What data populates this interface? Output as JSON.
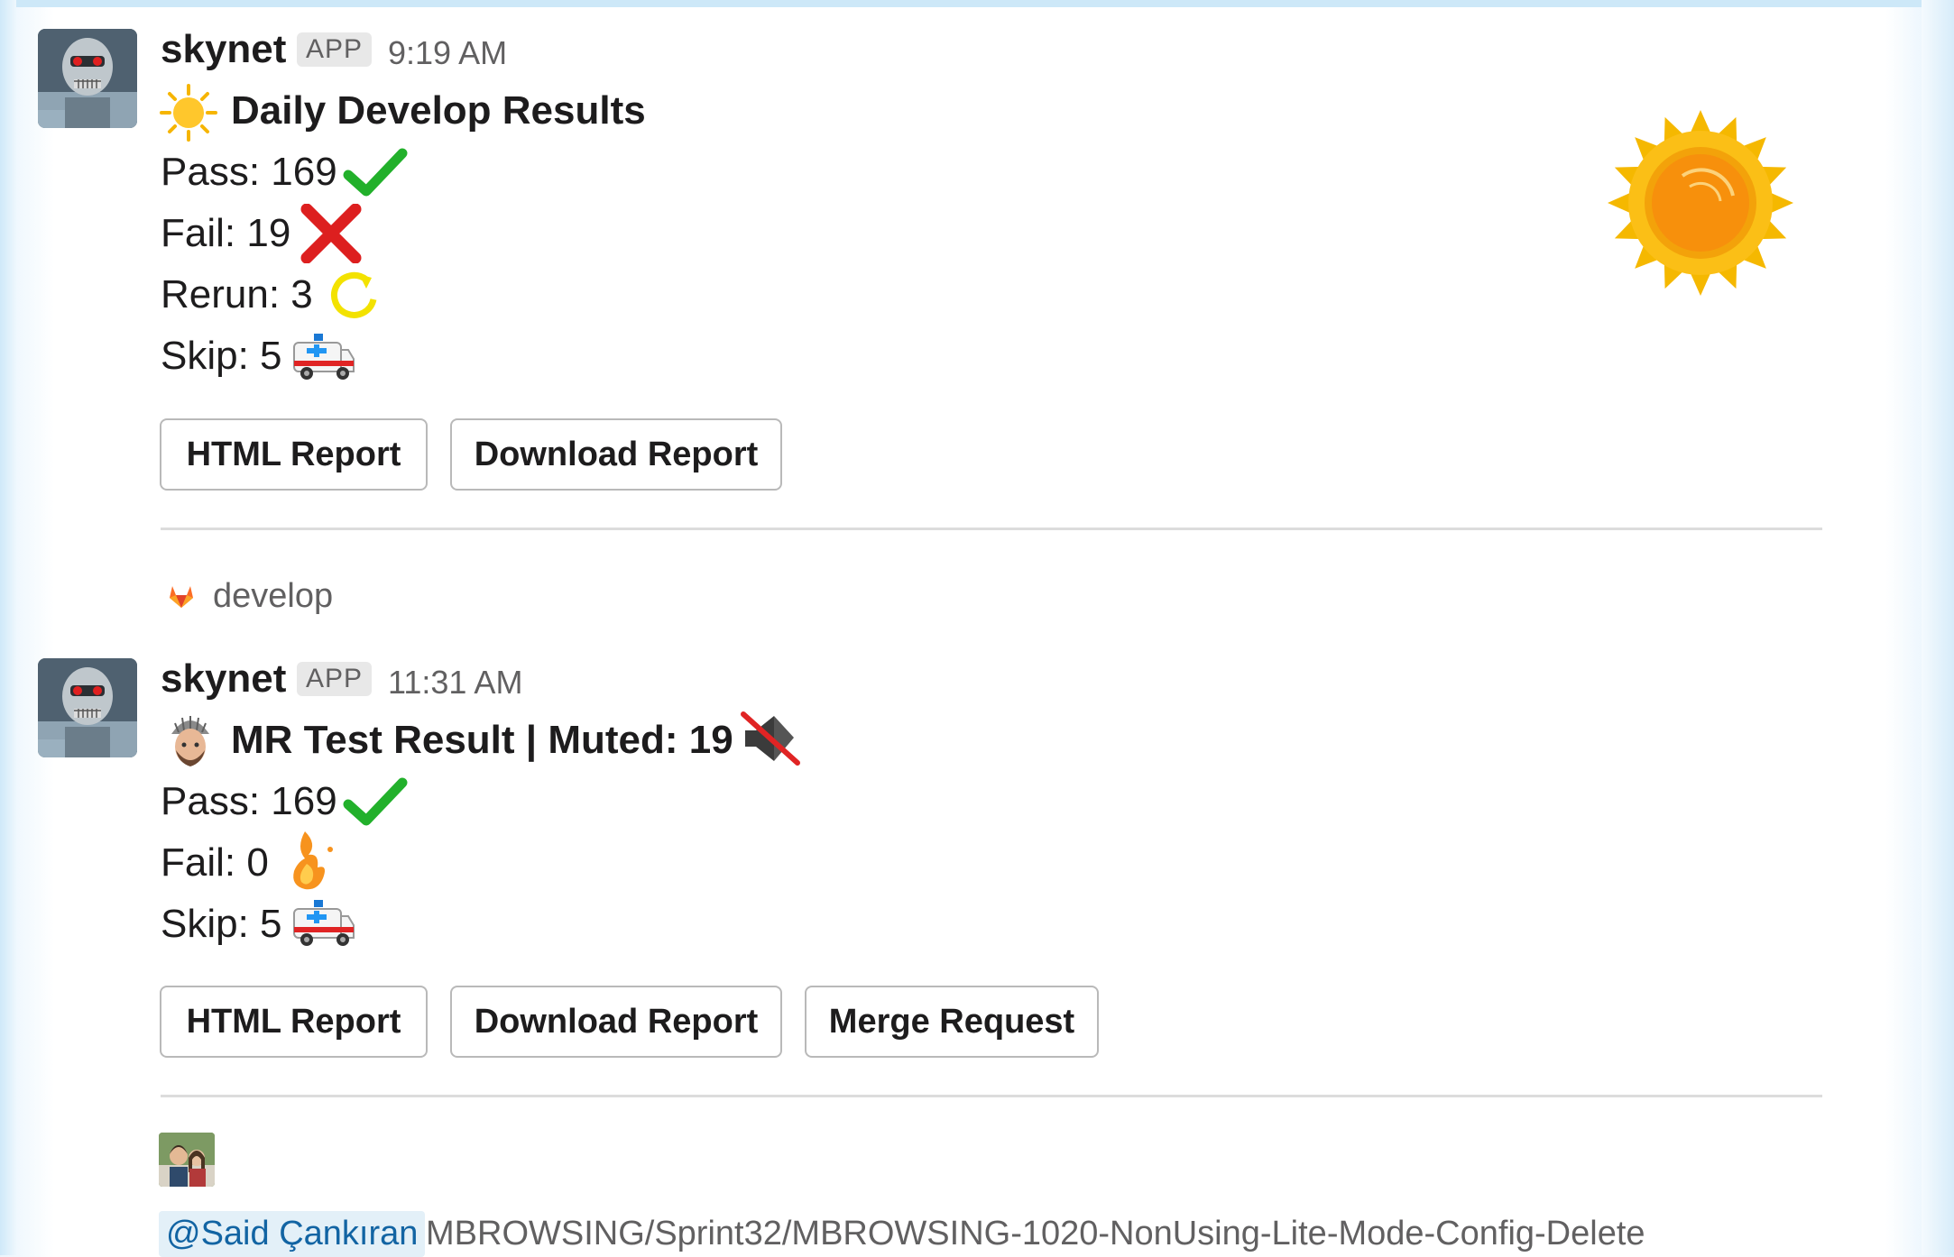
{
  "messages": [
    {
      "username": "skynet",
      "badge": "APP",
      "time": "9:19 AM",
      "title": "Daily Develop Results",
      "title_icon": "sun-icon",
      "stats": [
        {
          "text": "Pass: 169",
          "icon": "check-mark-icon"
        },
        {
          "text": "Fail: 19",
          "icon": "cross-mark-icon"
        },
        {
          "text": "Rerun: 3",
          "icon": "rerun-arrows-icon"
        },
        {
          "text": "Skip: 5",
          "icon": "ambulance-icon"
        }
      ],
      "buttons": [
        "HTML Report",
        "Download Report"
      ],
      "thumbnail": "sun-image"
    },
    {
      "username": "skynet",
      "badge": "APP",
      "time": "11:31 AM",
      "title": "MR Test Result | Muted: 19",
      "title_icon": "person-with-beanie-icon",
      "title_trailing_icon": "muted-speaker-icon",
      "stats": [
        {
          "text": "Pass: 169",
          "icon": "check-mark-icon"
        },
        {
          "text": "Fail: 0",
          "icon": "fire-icon"
        },
        {
          "text": "Skip: 5",
          "icon": "ambulance-icon"
        }
      ],
      "buttons": [
        "HTML Report",
        "Download Report",
        "Merge Request"
      ]
    }
  ],
  "context": {
    "label": "develop",
    "icon": "gitlab-fox-icon"
  },
  "footer": {
    "mention": "@Said Çankıran",
    "branch": "MBROWSING/Sprint32/MBROWSING-1020-NonUsing-Lite-Mode-Config-Delete"
  },
  "colors": {
    "check": "#22b02b",
    "cross": "#dd1f1f",
    "rerun": "#f3e200",
    "sun": "#f7b500",
    "mention_bg": "#e3f0f8",
    "mention_text": "#1264a3"
  }
}
